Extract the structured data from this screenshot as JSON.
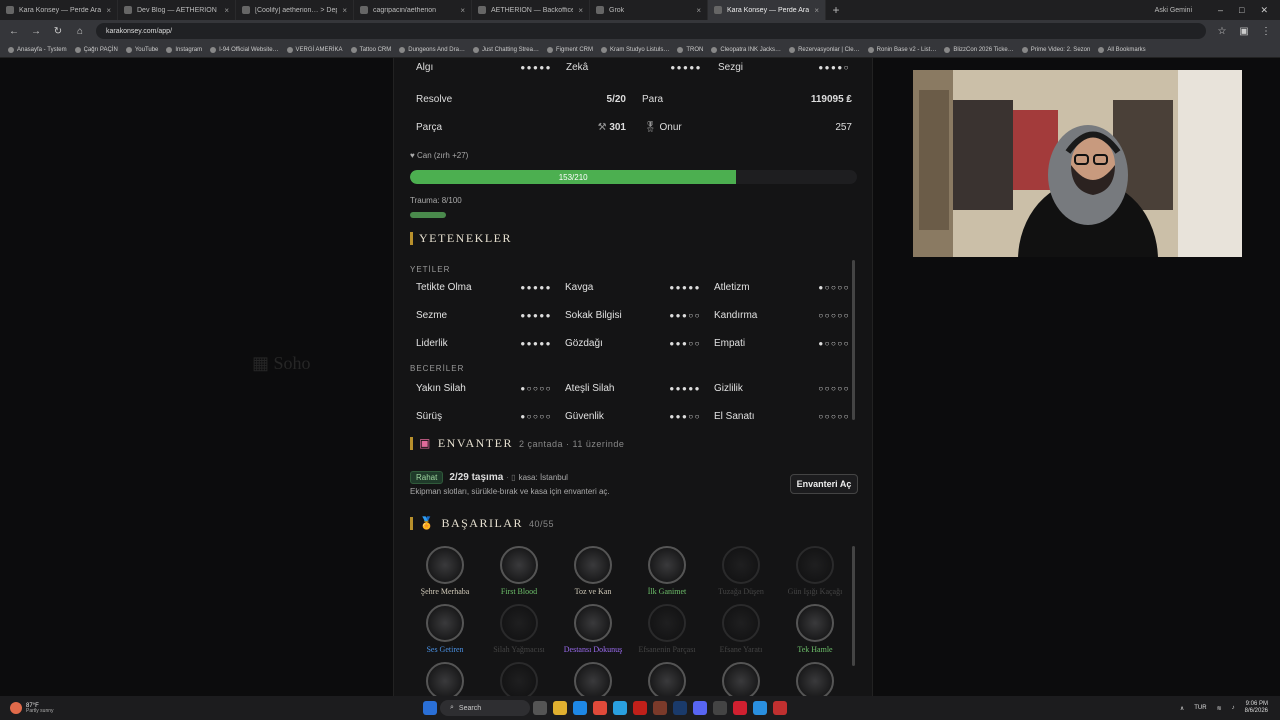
{
  "browser": {
    "tabs": [
      {
        "label": "Kara Konsey — Perde Aralanıy…",
        "active": false
      },
      {
        "label": "Dev Blog — AETHERION",
        "active": false
      },
      {
        "label": "[Coolify] aetherion… > Deploy…",
        "active": false
      },
      {
        "label": "cagripacin/aetherion",
        "active": false
      },
      {
        "label": "AETHERION — Backoffice",
        "active": false
      },
      {
        "label": "Grok",
        "active": false
      },
      {
        "label": "Kara Konsey — Perde Aralanıy…",
        "active": true
      }
    ],
    "profile_label": "Aski Gemini",
    "url": "karakonsey.com/app/",
    "bookmarks": [
      "Anasayfa - Tystem",
      "Çağrı PAÇİN",
      "YouTube",
      "Instagram",
      "I-94 Official Website…",
      "VERGİ AMERİKA",
      "Tattoo CRM",
      "Dungeons And Dra…",
      "Just Chatting Strea…",
      "Figment CRM",
      "Kram Studyo Listuls…",
      "TRON",
      "Cleopatra INK Jacks…",
      "Rezervasyonlar | Cle…",
      "Ronin Base v2 - List…",
      "BlizzCon 2026 Ticke…",
      "Prime Video: 2. Sezon",
      "All Bookmarks"
    ]
  },
  "stats": {
    "row1": [
      {
        "label": "Algı",
        "dots": "●●●●●"
      },
      {
        "label": "Zekâ",
        "dots": "●●●●●"
      },
      {
        "label": "Sezgi",
        "dots": "●●●●○"
      }
    ],
    "resolve_label": "Resolve",
    "resolve_value": "5/20",
    "para_label": "Para",
    "para_value": "119095 ₤",
    "parca_label": "Parça",
    "parca_value": "301",
    "onur_label": "Onur",
    "onur_value": "257"
  },
  "health": {
    "label": "Can (zırh +27)",
    "text": "153/210",
    "fraction": 0.73,
    "trauma_label": "Trauma: 8/100",
    "trauma_fraction": 0.08
  },
  "skills": {
    "title": "YETENEKLER",
    "yetiler_label": "YETİLER",
    "beceriler_label": "BECERİLER",
    "yetiler": [
      {
        "name": "Tetikte Olma",
        "dots": "●●●●●"
      },
      {
        "name": "Kavga",
        "dots": "●●●●●"
      },
      {
        "name": "Atletizm",
        "dots": "●○○○○"
      },
      {
        "name": "Sezme",
        "dots": "●●●●●"
      },
      {
        "name": "Sokak Bilgisi",
        "dots": "●●●○○"
      },
      {
        "name": "Kandırma",
        "dots": "○○○○○"
      },
      {
        "name": "Liderlik",
        "dots": "●●●●●"
      },
      {
        "name": "Gözdağı",
        "dots": "●●●○○"
      },
      {
        "name": "Empati",
        "dots": "●○○○○"
      }
    ],
    "beceriler": [
      {
        "name": "Yakın Silah",
        "dots": "●○○○○"
      },
      {
        "name": "Ateşli Silah",
        "dots": "●●●●●"
      },
      {
        "name": "Gizlilik",
        "dots": "○○○○○"
      },
      {
        "name": "Sürüş",
        "dots": "●○○○○"
      },
      {
        "name": "Güvenlik",
        "dots": "●●●○○"
      },
      {
        "name": "El Sanatı",
        "dots": "○○○○○"
      }
    ]
  },
  "inventory": {
    "title": "ENVANTER",
    "subtitle": "2 çantada · 11 üzerinde",
    "badge": "Rahat",
    "carry": "2/29 taşıma",
    "stash": "kasa: İstanbul",
    "hint": "Ekipman slotları, sürükle-bırak ve kasa için envanteri aç.",
    "open_button": "Envanteri Aç"
  },
  "achievements": {
    "title": "BAŞARILAR",
    "count": "40/55",
    "row1": [
      {
        "name": "Şehre Merhaba",
        "color": "#d0c9b8",
        "dim": false
      },
      {
        "name": "First Blood",
        "color": "#6dbf6a",
        "dim": false
      },
      {
        "name": "Toz ve Kan",
        "color": "#d0c9b8",
        "dim": false
      },
      {
        "name": "İlk Ganimet",
        "color": "#6dbf6a",
        "dim": false
      },
      {
        "name": "Tuzağa Düşen",
        "color": "#444",
        "dim": true
      },
      {
        "name": "Gün Işığı Kaçağı",
        "color": "#444",
        "dim": true
      }
    ],
    "row2": [
      {
        "name": "Ses Getiren",
        "color": "#4a90e2",
        "dim": false
      },
      {
        "name": "Silah Yağmacısı",
        "color": "#444",
        "dim": true
      },
      {
        "name": "Destansı Dokunuş",
        "color": "#9b6cf0",
        "dim": false
      },
      {
        "name": "Efsanenin Parçası",
        "color": "#444",
        "dim": true
      },
      {
        "name": "Efsane Yaratı",
        "color": "#444",
        "dim": true
      },
      {
        "name": "Tek Hamle",
        "color": "#6dbf6a",
        "dim": false
      }
    ]
  },
  "taskbar": {
    "weather_temp": "87°F",
    "weather_desc": "Partly sunny",
    "search": "Search",
    "lang": "TUR",
    "time": "9:06 PM",
    "date": "8/6/2026"
  }
}
